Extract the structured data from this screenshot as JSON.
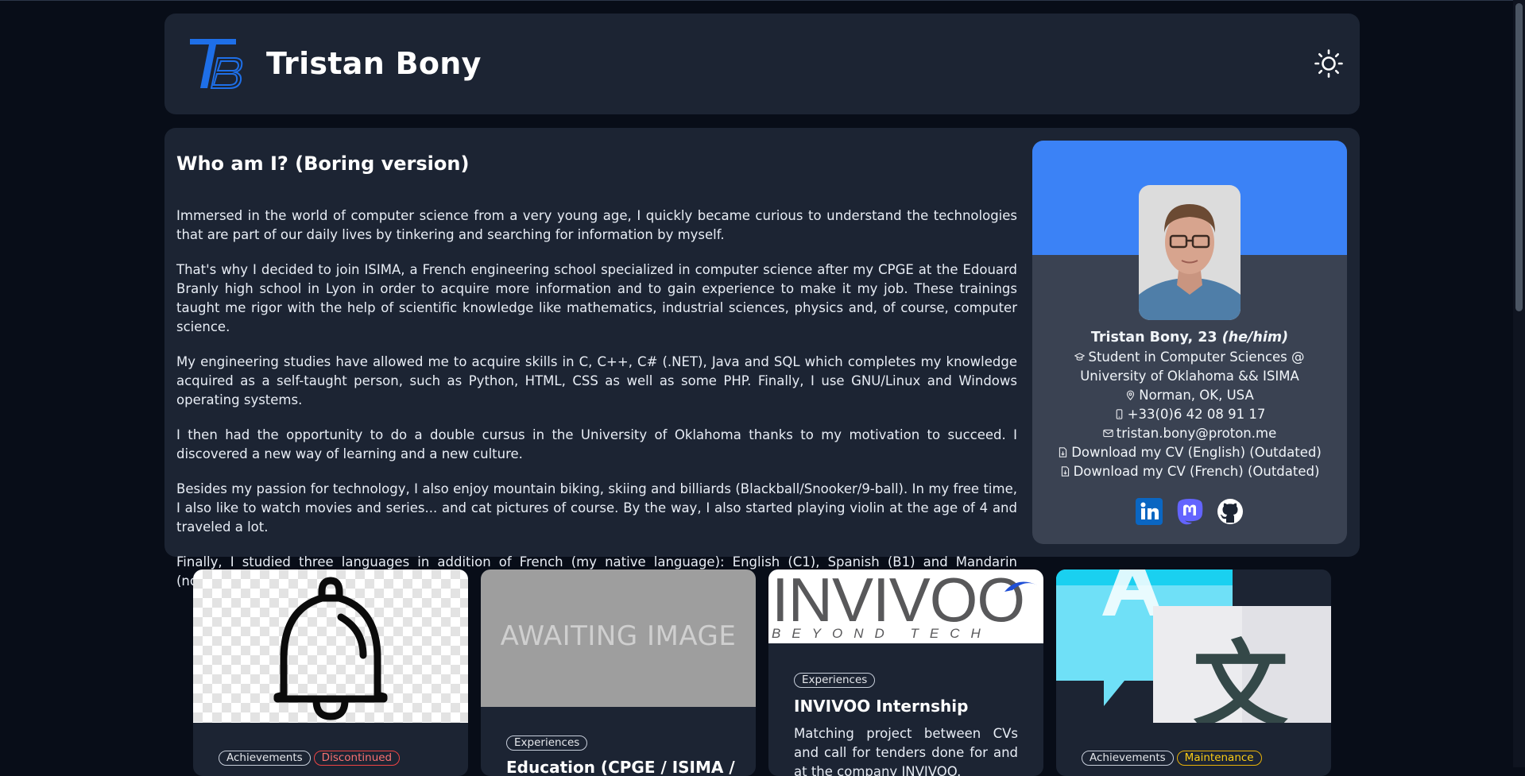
{
  "header": {
    "logo_text": "TB",
    "title": "Tristan Bony",
    "theme_toggle_icon": "sun-icon"
  },
  "about": {
    "heading": "Who am I? (Boring version)",
    "paragraphs": [
      "Immersed in the world of computer science from a very young age, I quickly became curious to understand the technologies that are part of our daily lives by tinkering and searching for information by myself.",
      "That's why I decided to join ISIMA, a French engineering school specialized in computer science after my CPGE at the Edouard Branly high school in Lyon in order to acquire more information and to gain experience to make it my job. These trainings taught me rigor with the help of scientific knowledge like mathematics, industrial sciences, physics and, of course, computer science.",
      "My engineering studies have allowed me to acquire skills in C, C++, C# (.NET), Java and SQL which completes my knowledge acquired as a self-taught person, such as Python, HTML, CSS as well as some PHP. Finally, I use GNU/Linux and Windows operating systems.",
      "I then had the opportunity to do a double cursus in the University of Oklahoma thanks to my motivation to succeed. I discovered a new way of learning and a new culture.",
      "Besides my passion for technology, I also enjoy mountain biking, skiing and billiards (Blackball/Snooker/9-ball). In my free time, I also like to watch movies and series... and cat pictures of course. By the way, I also started playing violin at the age of 4 and traveled a lot.",
      "Finally, I studied three languages in addition of French (my native language): English (C1), Spanish (B1) and Mandarin (notions)."
    ]
  },
  "profile": {
    "name": "Tristan Bony, 23",
    "pronouns": "(he/him)",
    "occupation": "Student in Computer Sciences @ University of Oklahoma && ISIMA",
    "location": "Norman, OK, USA",
    "phone": "+33(0)6 42 08 91 17",
    "email": "tristan.bony@proton.me",
    "cv_english": "Download my CV (English) (Outdated)",
    "cv_french": "Download my CV (French) (Outdated)",
    "socials": [
      "linkedin-icon",
      "mastodon-icon",
      "github-icon"
    ],
    "banner_color": "#3b82f6"
  },
  "cards": [
    {
      "image": "bell-icon",
      "tags": [
        "Achievements",
        "Discontinued"
      ],
      "title": "",
      "description": ""
    },
    {
      "image_text": "AWAITING IMAGE",
      "tags": [
        "Experiences"
      ],
      "title": "Education (CPGE / ISIMA /",
      "description": ""
    },
    {
      "image_text": "INVIVOO",
      "image_subtext": "BEYOND TECH",
      "tags": [
        "Experiences"
      ],
      "title": "INVIVOO Internship",
      "description": "Matching project between CVs and call for tenders done for and at the company INVIVOO."
    },
    {
      "image": "translate-icon",
      "image_text": "文",
      "tags": [
        "Achievements",
        "Maintenance"
      ],
      "title": "",
      "description": ""
    }
  ],
  "colors": {
    "background": "#080d18",
    "panel": "#1c2433",
    "accent": "#3b82f6",
    "tag_discontinued": "#ef4444",
    "tag_maintenance": "#eab308"
  }
}
